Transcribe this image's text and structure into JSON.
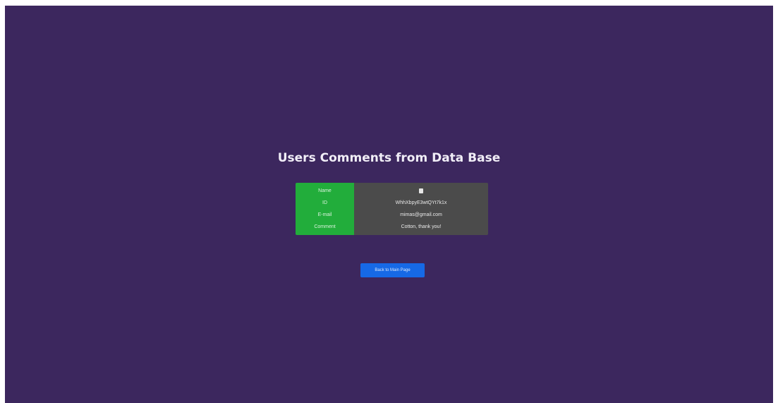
{
  "page": {
    "title": "Users Comments from Data Base",
    "background_color": "#3c275e",
    "accent_color": "#22ad3b",
    "button_color": "#1669e6"
  },
  "comment": {
    "labels": {
      "name": "Name",
      "id": "ID",
      "email": "E-mail",
      "comment": "Comment"
    },
    "values": {
      "name_icon": "user-icon",
      "id": "WhhXbpyE3wtQYt7k1x",
      "email": "mimas@gmail.com",
      "comment": "Cotton, thank you!"
    }
  },
  "actions": {
    "back_label": "Back to Main Page"
  }
}
